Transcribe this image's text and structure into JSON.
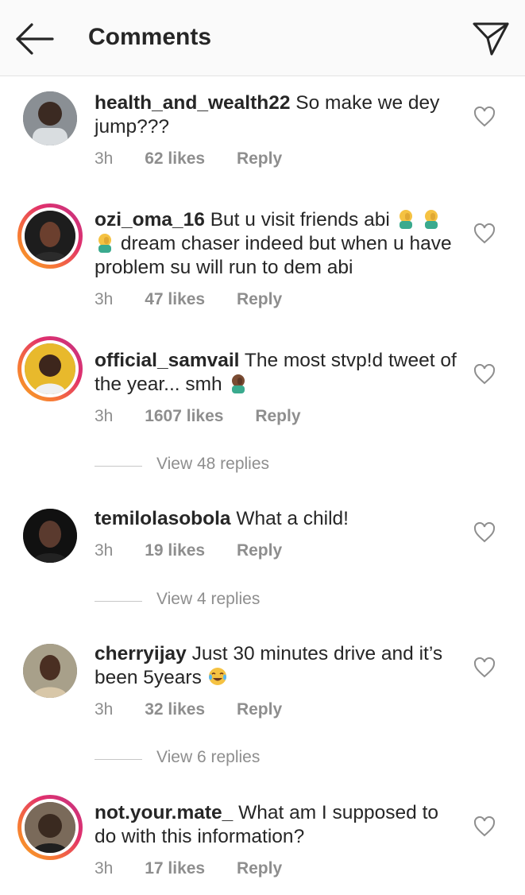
{
  "header": {
    "title": "Comments",
    "back_icon": "arrow-left-icon",
    "send_icon": "paper-plane-icon"
  },
  "colors": {
    "text": "#262626",
    "meta": "#8e8e8e",
    "story_ring": [
      "#f5a623",
      "#e1306c",
      "#c13584"
    ],
    "header_bg": "#fafafa"
  },
  "comments": [
    {
      "username": "health_and_wealth22",
      "body": "So make we dey jump???",
      "time": "3h",
      "likes": "62 likes",
      "reply": "Reply",
      "avatar_ring": "plain",
      "avatar_colors": [
        "#8a8f94",
        "#3b2a22"
      ]
    },
    {
      "username": "ozi_oma_16",
      "body_parts": [
        "But u visit friends abi",
        "dream chaser indeed but when u have problem su will run to dem abi"
      ],
      "time": "3h",
      "likes": "47 likes",
      "reply": "Reply",
      "avatar_ring": "story",
      "avatar_colors": [
        "#1d1d1d",
        "#6b3f2e"
      ]
    },
    {
      "username": "official_samvail",
      "body": "The most stvp!d tweet of the year... smh",
      "time": "3h",
      "likes": "1607 likes",
      "reply": "Reply",
      "avatar_ring": "story",
      "avatar_colors": [
        "#e8b92c",
        "#3d261c"
      ],
      "replies_label": "View 48 replies"
    },
    {
      "username": "temilolasobola",
      "body": "What a child!",
      "time": "3h",
      "likes": "19 likes",
      "reply": "Reply",
      "avatar_ring": "plain",
      "avatar_colors": [
        "#111111",
        "#5a3a2e"
      ],
      "replies_label": "View 4 replies"
    },
    {
      "username": "cherryijay",
      "body": "Just 30 minutes drive and it’s been 5years",
      "time": "3h",
      "likes": "32 likes",
      "reply": "Reply",
      "avatar_ring": "plain",
      "avatar_colors": [
        "#a8a08a",
        "#4a2f22"
      ],
      "replies_label": "View 6 replies"
    },
    {
      "username": "not.your.mate_",
      "body": "What am I supposed to do with this information?",
      "time": "3h",
      "likes": "17 likes",
      "reply": "Reply",
      "avatar_ring": "story",
      "avatar_colors": [
        "#7a6a5a",
        "#3a2a20"
      ]
    }
  ]
}
